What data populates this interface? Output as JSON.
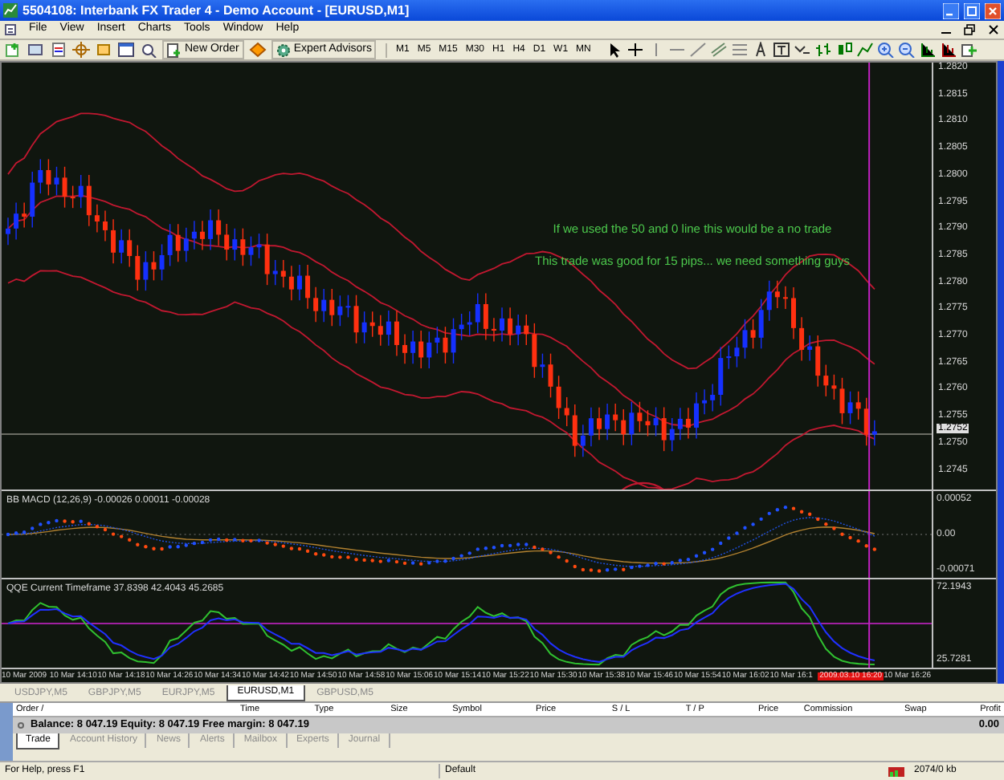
{
  "window": {
    "title": "5504108: Interbank FX Trader 4 - Demo Account - [EURUSD,M1]"
  },
  "menu": [
    "File",
    "View",
    "Insert",
    "Charts",
    "Tools",
    "Window",
    "Help"
  ],
  "toolbar": {
    "new_order": "New Order",
    "expert_advisors": "Expert Advisors",
    "timeframes": [
      "M1",
      "M5",
      "M15",
      "M30",
      "H1",
      "H4",
      "D1",
      "W1",
      "MN"
    ]
  },
  "chart": {
    "annotations": [
      "If we used the 50 and 0 line this would be a no trade",
      "This trade was good for 15 pips... we need something guys"
    ],
    "price_axis": [
      "1.2820",
      "1.2815",
      "1.2810",
      "1.2805",
      "1.2800",
      "1.2795",
      "1.2790",
      "1.2785",
      "1.2780",
      "1.2775",
      "1.2770",
      "1.2765",
      "1.2760",
      "1.2755",
      "1.2750",
      "1.2745"
    ],
    "current_price": "1.2752",
    "macd": {
      "label": "BB MACD (12,26,9) -0.00026 0.00011 -0.00028",
      "axis": [
        "0.00052",
        "0.00",
        "-0.00071"
      ]
    },
    "qqe": {
      "label": "QQE Current Timeframe 37.8398 42.4043 45.2685",
      "axis": [
        "72.1943",
        "25.7281"
      ]
    },
    "time_axis": [
      {
        "text": "10 Mar 2009",
        "highlighted": false
      },
      {
        "text": "10 Mar 14:10",
        "highlighted": false
      },
      {
        "text": "10 Mar 14:18",
        "highlighted": false
      },
      {
        "text": "10 Mar 14:26",
        "highlighted": false
      },
      {
        "text": "10 Mar 14:34",
        "highlighted": false
      },
      {
        "text": "10 Mar 14:42",
        "highlighted": false
      },
      {
        "text": "10 Mar 14:50",
        "highlighted": false
      },
      {
        "text": "10 Mar 14:58",
        "highlighted": false
      },
      {
        "text": "10 Mar 15:06",
        "highlighted": false
      },
      {
        "text": "10 Mar 15:14",
        "highlighted": false
      },
      {
        "text": "10 Mar 15:22",
        "highlighted": false
      },
      {
        "text": "10 Mar 15:30",
        "highlighted": false
      },
      {
        "text": "10 Mar 15:38",
        "highlighted": false
      },
      {
        "text": "10 Mar 15:46",
        "highlighted": false
      },
      {
        "text": "10 Mar 15:54",
        "highlighted": false
      },
      {
        "text": "10 Mar 16:02",
        "highlighted": false
      },
      {
        "text": "10 Mar 16:1",
        "highlighted": false
      },
      {
        "text": "2009.03.10 16:20",
        "highlighted": true
      },
      {
        "text": "10 Mar 16:26",
        "highlighted": false
      }
    ]
  },
  "chart_tabs": [
    {
      "label": "USDJPY,M5",
      "selected": false
    },
    {
      "label": "GBPJPY,M5",
      "selected": false
    },
    {
      "label": "EURJPY,M5",
      "selected": false
    },
    {
      "label": "EURUSD,M1",
      "selected": true
    },
    {
      "label": "GBPUSD,M5",
      "selected": false
    }
  ],
  "terminal": {
    "columns": [
      "Order  /",
      "Time",
      "Type",
      "Size",
      "Symbol",
      "Price",
      "S / L",
      "T / P",
      "Price",
      "Commission",
      "Swap",
      "Profit"
    ],
    "balance": "Balance: 8 047.19  Equity: 8 047.19  Free margin: 8 047.19",
    "profit": "0.00",
    "tabs": [
      {
        "label": "Trade",
        "selected": true
      },
      {
        "label": "Account History",
        "selected": false
      },
      {
        "label": "News",
        "selected": false
      },
      {
        "label": "Alerts",
        "selected": false
      },
      {
        "label": "Mailbox",
        "selected": false
      },
      {
        "label": "Experts",
        "selected": false
      },
      {
        "label": "Journal",
        "selected": false
      }
    ]
  },
  "status_bar": {
    "help": "For Help, press F1",
    "profile": "Default",
    "traffic": "2074/0 kb"
  }
}
